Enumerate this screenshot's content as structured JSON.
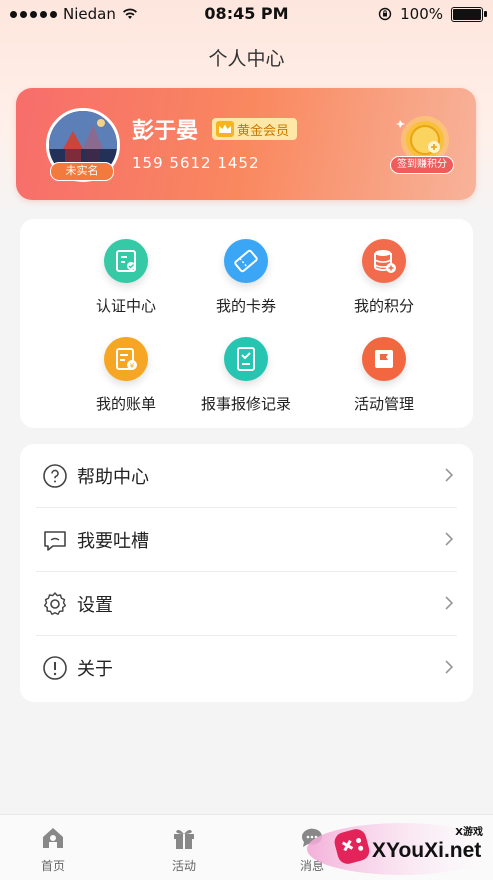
{
  "status_bar": {
    "carrier": "Niedan",
    "time": "08:45 PM",
    "battery": "100%"
  },
  "page": {
    "title": "个人中心"
  },
  "profile": {
    "name": "彭于晏",
    "member_label": "黄金会员",
    "phone": "159 5612 1452",
    "unverified_label": "未实名",
    "sign_label": "签到赚积分"
  },
  "grid": [
    {
      "label": "认证中心",
      "icon": "certificate-icon",
      "color": "#35c9a5"
    },
    {
      "label": "我的卡券",
      "icon": "ticket-icon",
      "color": "#3aa6f5"
    },
    {
      "label": "我的积分",
      "icon": "points-database-icon",
      "color": "#f26b4d"
    },
    {
      "label": "我的账单",
      "icon": "bill-icon",
      "color": "#f6a623"
    },
    {
      "label": "报事报修记录",
      "icon": "repair-record-icon",
      "color": "#26c5b2"
    },
    {
      "label": "活动管理",
      "icon": "activity-flag-icon",
      "color": "#f2673f"
    }
  ],
  "menu": [
    {
      "label": "帮助中心",
      "icon": "help-icon"
    },
    {
      "label": "我要吐槽",
      "icon": "feedback-message-icon"
    },
    {
      "label": "设置",
      "icon": "settings-gear-icon"
    },
    {
      "label": "关于",
      "icon": "info-icon"
    }
  ],
  "tabs": [
    {
      "label": "首页",
      "icon": "home-icon"
    },
    {
      "label": "活动",
      "icon": "gift-icon"
    },
    {
      "label": "消息",
      "icon": "message-icon"
    }
  ],
  "watermark": {
    "small": "X游戏",
    "domain": "XYouXi.net"
  },
  "colors": {
    "card_start": "#f76d6b",
    "card_end": "#f8b39a",
    "gold": "#f6b51e",
    "accent": "#f05c5c"
  }
}
